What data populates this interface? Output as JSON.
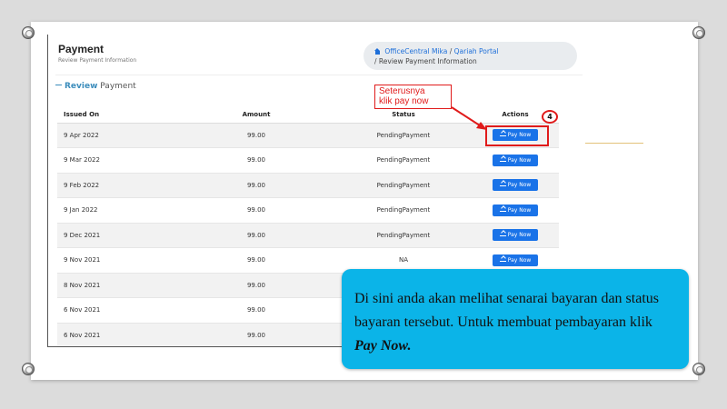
{
  "page": {
    "title": "Payment",
    "subtitle": "Review Payment Information"
  },
  "breadcrumb": {
    "item1": "OfficeCentral Mika",
    "sep1": "/",
    "item2": "Qariah Portal",
    "sep2": "/",
    "item3": "Review Payment Information"
  },
  "section": {
    "bold": "Review",
    "rest": "Payment"
  },
  "table": {
    "headers": [
      "Issued On",
      "Amount",
      "Status",
      "Actions"
    ],
    "rows": [
      {
        "issued": "9 Apr 2022",
        "amount": "99.00",
        "status": "PendingPayment",
        "action": "Pay Now"
      },
      {
        "issued": "9 Mar 2022",
        "amount": "99.00",
        "status": "PendingPayment",
        "action": "Pay Now"
      },
      {
        "issued": "9 Feb 2022",
        "amount": "99.00",
        "status": "PendingPayment",
        "action": "Pay Now"
      },
      {
        "issued": "9 Jan 2022",
        "amount": "99.00",
        "status": "PendingPayment",
        "action": "Pay Now"
      },
      {
        "issued": "9 Dec 2021",
        "amount": "99.00",
        "status": "PendingPayment",
        "action": "Pay Now"
      },
      {
        "issued": "9 Nov 2021",
        "amount": "99.00",
        "status": "NA",
        "action": "Pay Now"
      },
      {
        "issued": "8 Nov 2021",
        "amount": "99.00",
        "status": "",
        "action": ""
      },
      {
        "issued": "6 Nov 2021",
        "amount": "99.00",
        "status": "",
        "action": ""
      },
      {
        "issued": "6 Nov 2021",
        "amount": "99.00",
        "status": "",
        "action": ""
      }
    ]
  },
  "annotation": {
    "callout_line1": "Seterusnya",
    "callout_line2": "klik pay now",
    "step_number": "4",
    "highlight_color": "#e01b1b"
  },
  "info_box": {
    "text": "Di sini anda akan melihat senarai bayaran dan status bayaran tersebut. Untuk membuat pembayaran klik",
    "emphasis": "Pay Now.",
    "background": "#0bb4e8"
  },
  "colors": {
    "button": "#1a73e8",
    "accent": "#3c8dbc"
  },
  "icons": {
    "home": "home-icon",
    "pay": "pay-icon",
    "screw": "screw-icon"
  }
}
